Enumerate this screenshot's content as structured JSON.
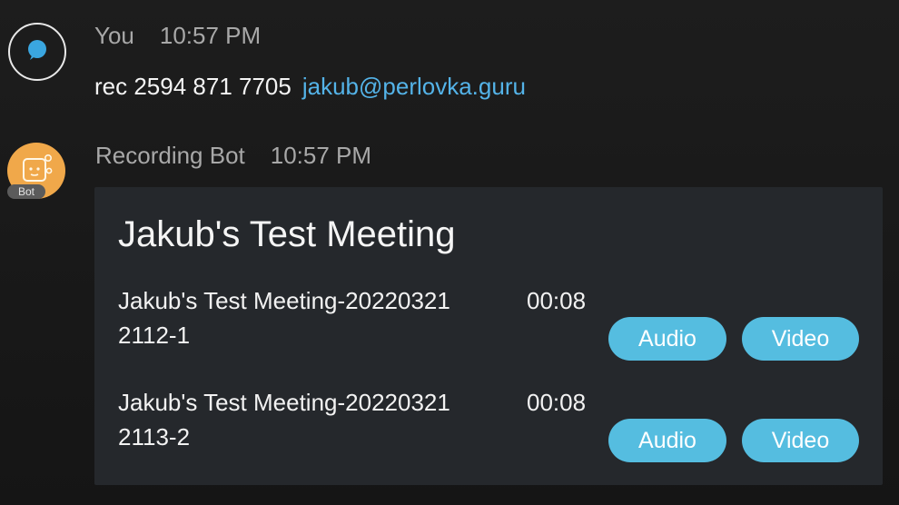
{
  "messages": [
    {
      "sender": "You",
      "time": "10:57 PM",
      "text": "rec 2594 871 7705",
      "link": "jakub@perlovka.guru",
      "avatar_icon": "chat-bubble-icon"
    },
    {
      "sender": "Recording Bot",
      "time": "10:57 PM",
      "badge": "Bot",
      "avatar_icon": "bot-face-icon"
    }
  ],
  "card": {
    "title": "Jakub's Test Meeting",
    "recordings": [
      {
        "name_line1": "Jakub's Test Meeting-20220321",
        "name_line2": "2112-1",
        "duration": "00:08",
        "audio_label": "Audio",
        "video_label": "Video"
      },
      {
        "name_line1": "Jakub's Test Meeting-20220321",
        "name_line2": "2113-2",
        "duration": "00:08",
        "audio_label": "Audio",
        "video_label": "Video"
      }
    ]
  },
  "colors": {
    "background": "#1a1a1a",
    "card": "#25282c",
    "accent_button": "#55bde0",
    "link": "#54b3e8",
    "bot_avatar": "#f0a84a"
  }
}
